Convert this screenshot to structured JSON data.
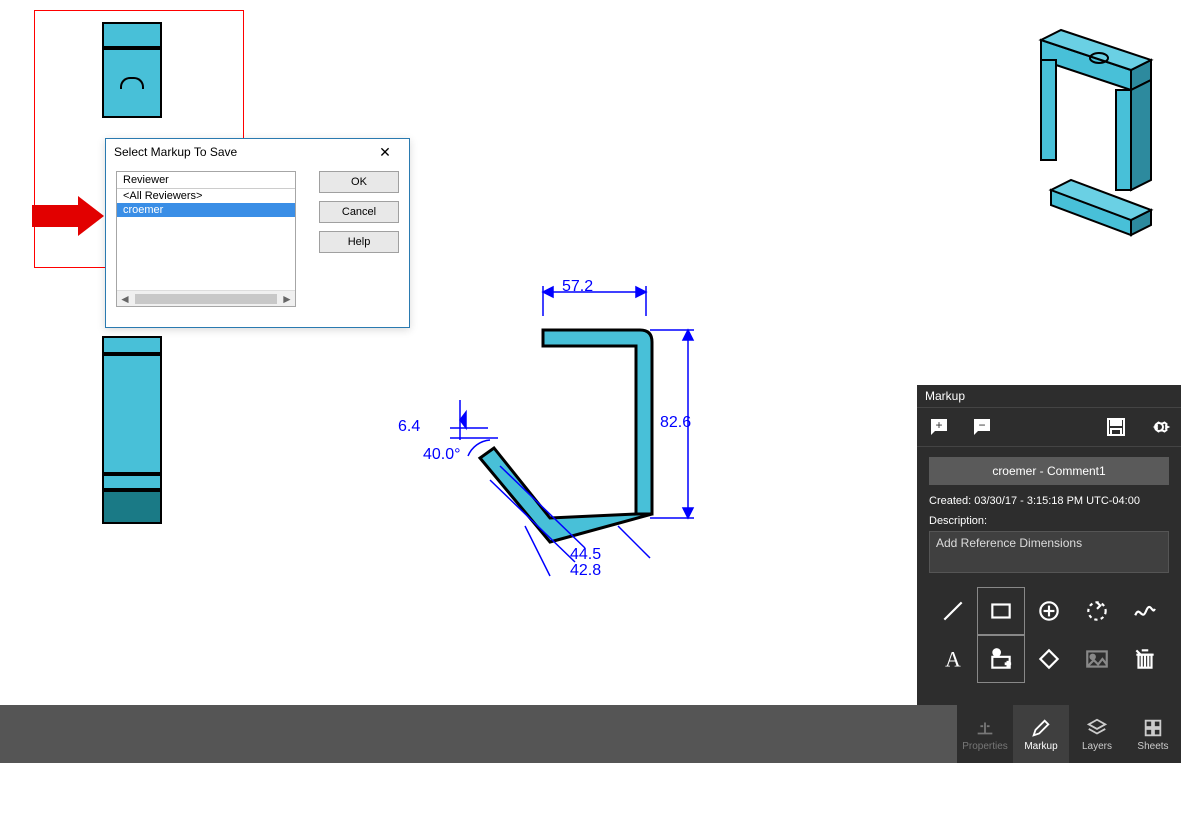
{
  "dialog": {
    "title": "Select Markup To Save",
    "list_header": "Reviewer",
    "rows": [
      "<All Reviewers>",
      "croemer"
    ],
    "selected_index": 1,
    "buttons": {
      "ok": "OK",
      "cancel": "Cancel",
      "help": "Help"
    }
  },
  "dimensions": {
    "top_width": "57.2",
    "right_height": "82.6",
    "left_small": "6.4",
    "angle": "40.0°",
    "diag1": "44.5",
    "diag2": "42.8"
  },
  "markup": {
    "title": "Markup",
    "comment_item": "croemer - Comment1",
    "created": "Created: 03/30/17 - 3:15:18 PM UTC-04:00",
    "desc_label": "Description:",
    "desc_value": "Add Reference Dimensions",
    "tools": [
      "line",
      "rectangle",
      "circle-plus",
      "circle-arrow",
      "freehand",
      "text",
      "stamp",
      "erase",
      "image",
      "trash"
    ]
  },
  "tabs": {
    "properties": "Properties",
    "markup": "Markup",
    "layers": "Layers",
    "sheets": "Sheets"
  }
}
